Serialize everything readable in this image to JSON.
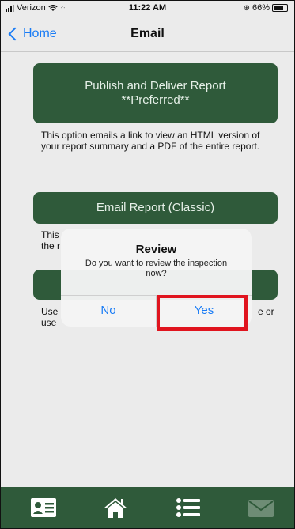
{
  "status_bar": {
    "carrier": "Verizon",
    "time": "11:22 AM",
    "battery": "66%"
  },
  "nav": {
    "back_label": "Home",
    "title": "Email"
  },
  "options": [
    {
      "label_line1": "Publish and Deliver Report",
      "label_line2": "**Preferred**",
      "description": "This option emails a link to view an HTML version of your report summary and a PDF of the entire report."
    },
    {
      "label": "Email Report (Classic)",
      "description_visible": "This",
      "description_visible2": "the r"
    },
    {
      "label": "",
      "description_visible": "Use",
      "description_visible2": "use",
      "description_right": "e or"
    }
  ],
  "dialog": {
    "title": "Review",
    "message": "Do you want to review the inspection now?",
    "no_label": "No",
    "yes_label": "Yes"
  },
  "tabbar": {
    "items": [
      "contact-card-icon",
      "home-icon",
      "list-icon",
      "mail-icon"
    ]
  },
  "colors": {
    "accent": "#2f5a3a",
    "link": "#1a7cf5",
    "highlight": "#e0141e"
  }
}
